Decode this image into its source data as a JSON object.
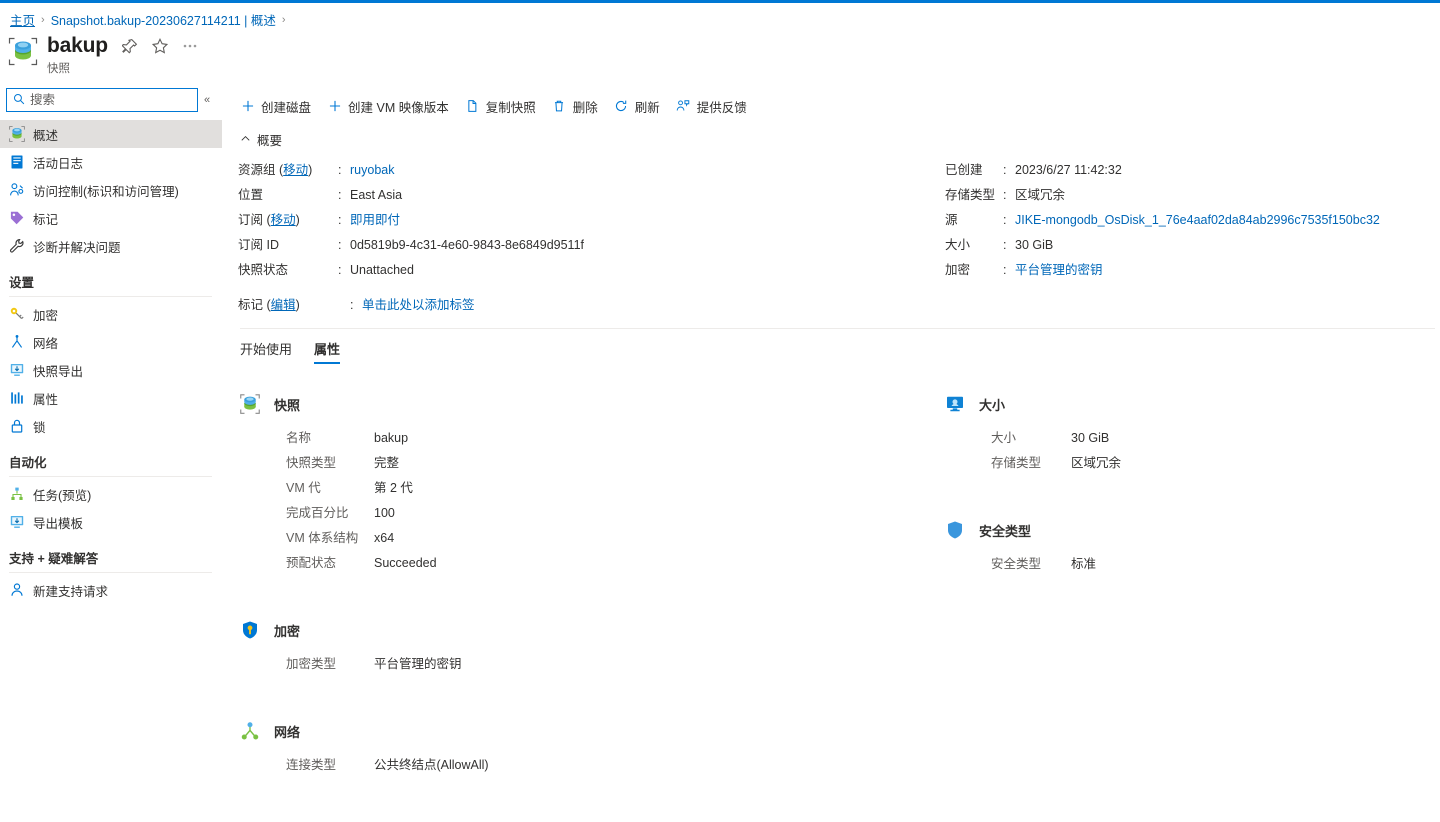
{
  "theme": {
    "accent": "#0078d4",
    "link": "#0067b8",
    "text": "#323130",
    "muted": "#605e5c",
    "active_bg": "#e1dfdd"
  },
  "breadcrumb": {
    "home": "主页",
    "separator": "›",
    "current": "Snapshot.bakup-20230627114211 | 概述",
    "trailing_separator": "›"
  },
  "resource_header": {
    "icon": "snapshot-icon",
    "title": "bakup",
    "subtitle": "快照",
    "pin_icon": "pin-icon",
    "favorite_icon": "star-icon",
    "more_icon": "ellipsis-icon"
  },
  "sidebar": {
    "search": {
      "placeholder": "搜索",
      "value": "",
      "icon": "search-icon"
    },
    "collapse_icon": "chevron-double-left-icon",
    "items": [
      {
        "label": "概述",
        "icon": "snapshot-icon",
        "active": true
      },
      {
        "label": "活动日志",
        "icon": "activity-log-icon",
        "active": false
      },
      {
        "label": "访问控制(标识和访问管理)",
        "icon": "access-control-icon",
        "active": false
      },
      {
        "label": "标记",
        "icon": "tag-icon",
        "active": false
      },
      {
        "label": "诊断并解决问题",
        "icon": "wrench-icon",
        "active": false
      }
    ],
    "sections": [
      {
        "title": "设置",
        "items": [
          {
            "label": "加密",
            "icon": "key-icon"
          },
          {
            "label": "网络",
            "icon": "network-icon"
          },
          {
            "label": "快照导出",
            "icon": "export-icon"
          },
          {
            "label": "属性",
            "icon": "properties-icon"
          },
          {
            "label": "锁",
            "icon": "lock-icon"
          }
        ]
      },
      {
        "title": "自动化",
        "items": [
          {
            "label": "任务(预览)",
            "icon": "tasks-icon"
          },
          {
            "label": "导出模板",
            "icon": "export-template-icon"
          }
        ]
      },
      {
        "title": "支持 + 疑难解答",
        "items": [
          {
            "label": "新建支持请求",
            "icon": "support-request-icon"
          }
        ]
      }
    ]
  },
  "command_bar": [
    {
      "label": "创建磁盘",
      "icon": "plus-icon"
    },
    {
      "label": "创建 VM 映像版本",
      "icon": "plus-icon"
    },
    {
      "label": "复制快照",
      "icon": "copy-icon"
    },
    {
      "label": "删除",
      "icon": "trash-icon"
    },
    {
      "label": "刷新",
      "icon": "refresh-icon"
    },
    {
      "label": "提供反馈",
      "icon": "feedback-icon"
    }
  ],
  "essentials": {
    "toggle_label": "概要",
    "toggle_icon": "chevron-up-icon",
    "left": [
      {
        "label": "资源组",
        "sublink": "移动",
        "colon": ":",
        "value": "ruyobak",
        "is_link": true
      },
      {
        "label": "位置",
        "sublink": "",
        "colon": ":",
        "value": "East Asia",
        "is_link": false
      },
      {
        "label": "订阅",
        "sublink": "移动",
        "colon": ":",
        "value": "即用即付",
        "is_link": true
      },
      {
        "label": "订阅 ID",
        "sublink": "",
        "colon": ":",
        "value": "0d5819b9-4c31-4e60-9843-8e6849d9511f",
        "is_link": false
      },
      {
        "label": "快照状态",
        "sublink": "",
        "colon": ":",
        "value": "Unattached",
        "is_link": false
      }
    ],
    "right": [
      {
        "label": "已创建",
        "colon": ":",
        "value": "2023/6/27 11:42:32",
        "is_link": false
      },
      {
        "label": "存储类型",
        "colon": ":",
        "value": "区域冗余",
        "is_link": false
      },
      {
        "label": "源",
        "colon": ":",
        "value": "JIKE-mongodb_OsDisk_1_76e4aaf02da84ab2996c7535f150bc32",
        "is_link": true
      },
      {
        "label": "大小",
        "colon": ":",
        "value": "30 GiB",
        "is_link": false
      },
      {
        "label": "加密",
        "colon": ":",
        "value": "平台管理的密钥",
        "is_link": true
      }
    ],
    "tags": {
      "label": "标记",
      "sublink": "编辑",
      "colon": ":",
      "value": "单击此处以添加标签"
    }
  },
  "tabs": [
    {
      "label": "开始使用",
      "active": false
    },
    {
      "label": "属性",
      "active": true
    }
  ],
  "property_cards": {
    "left": [
      {
        "title": "快照",
        "icon": "snapshot-icon",
        "rows": [
          {
            "key": "名称",
            "value": "bakup"
          },
          {
            "key": "快照类型",
            "value": "完整"
          },
          {
            "key": "VM 代",
            "value": "第 2 代"
          },
          {
            "key": "完成百分比",
            "value": "100"
          },
          {
            "key": "VM 体系结构",
            "value": "x64"
          },
          {
            "key": "预配状态",
            "value": "Succeeded"
          }
        ]
      },
      {
        "title": "加密",
        "icon": "shield-key-icon",
        "rows": [
          {
            "key": "加密类型",
            "value": "平台管理的密钥"
          }
        ]
      },
      {
        "title": "网络",
        "icon": "network-icon",
        "rows": [
          {
            "key": "连接类型",
            "value": "公共终结点(AllowAll)"
          }
        ]
      }
    ],
    "right": [
      {
        "title": "大小",
        "icon": "size-monitor-icon",
        "rows": [
          {
            "key": "大小",
            "value": "30 GiB"
          },
          {
            "key": "存储类型",
            "value": "区域冗余"
          }
        ]
      },
      {
        "title": "安全类型",
        "icon": "shield-icon",
        "rows": [
          {
            "key": "安全类型",
            "value": "标准"
          }
        ]
      }
    ]
  }
}
